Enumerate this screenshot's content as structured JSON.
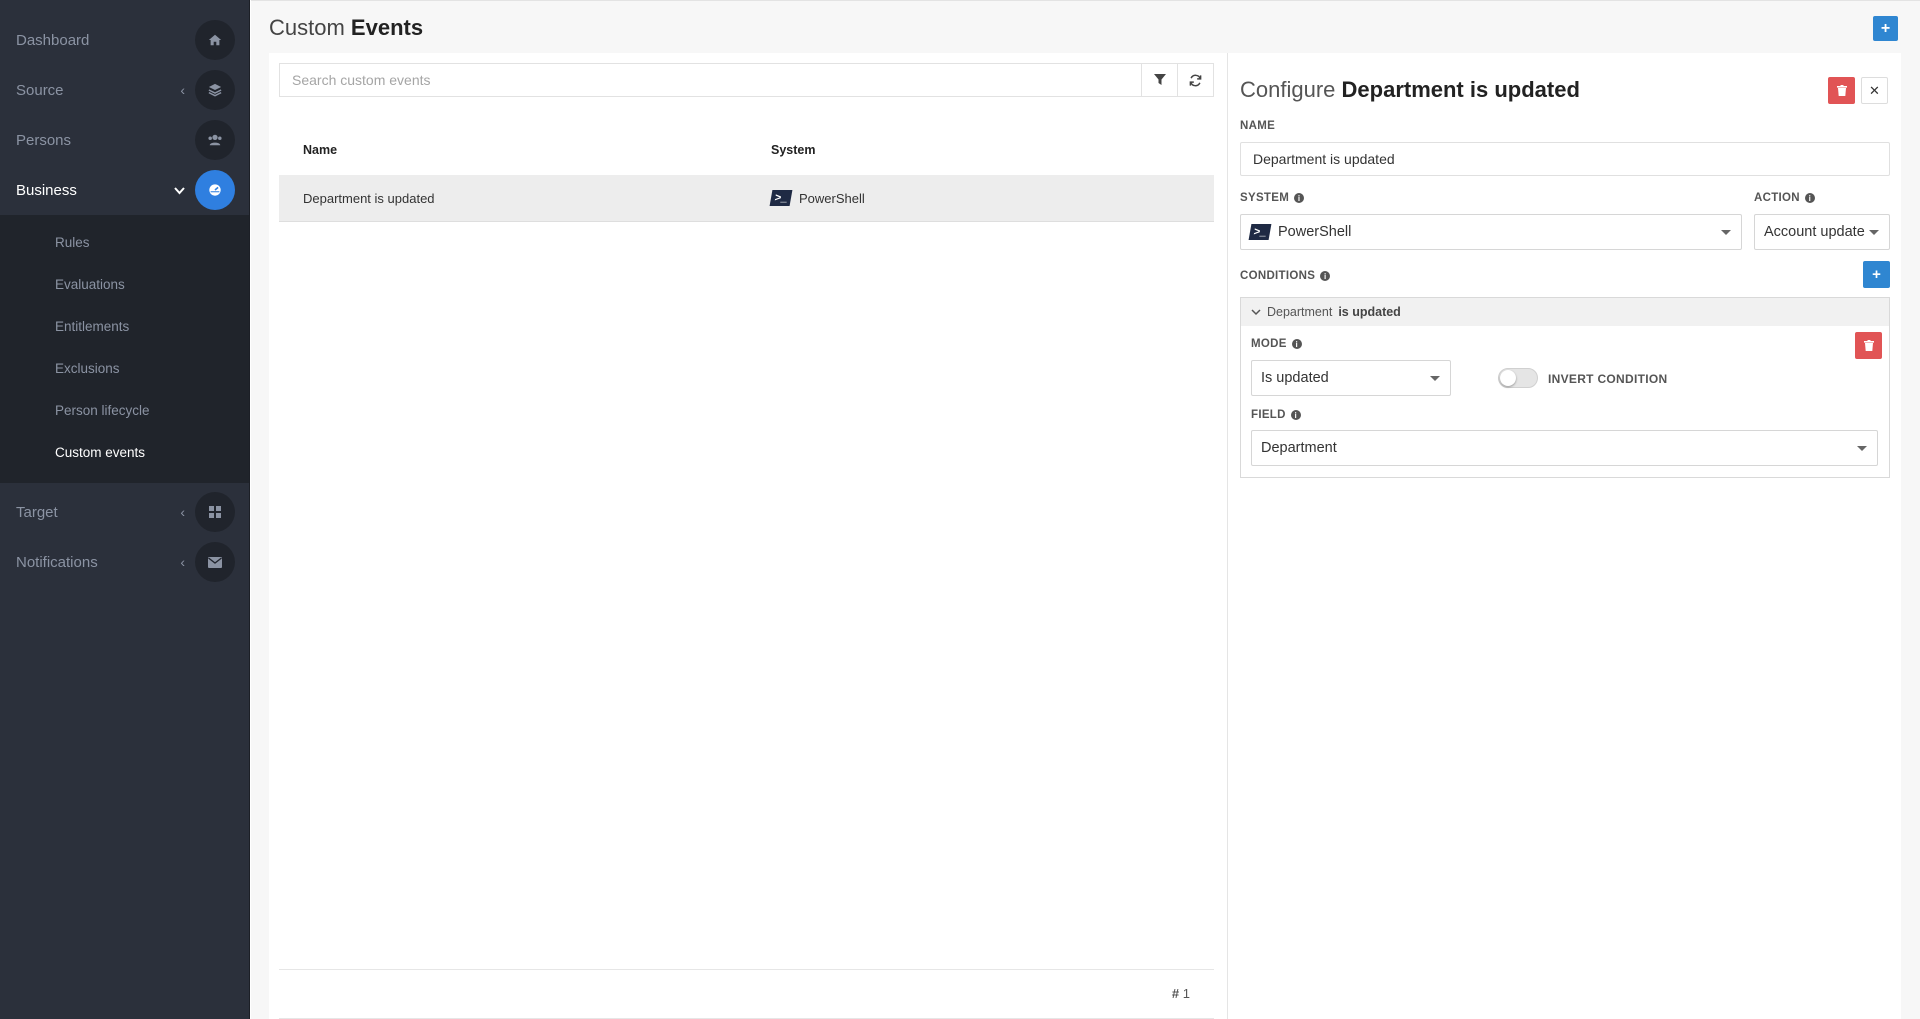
{
  "sidebar": {
    "items": [
      {
        "label": "Dashboard",
        "icon": "home-icon"
      },
      {
        "label": "Source",
        "icon": "layers-icon"
      },
      {
        "label": "Persons",
        "icon": "users-icon"
      },
      {
        "label": "Business",
        "icon": "dashboard-gauge-icon"
      },
      {
        "label": "Target",
        "icon": "grid-icon"
      },
      {
        "label": "Notifications",
        "icon": "envelope-icon"
      }
    ],
    "business_sub": [
      "Rules",
      "Evaluations",
      "Entitlements",
      "Exclusions",
      "Person lifecycle",
      "Custom events"
    ],
    "active_item": "Business",
    "active_sub": "Custom events"
  },
  "header": {
    "title_light": "Custom",
    "title_bold": "Events"
  },
  "list": {
    "search_placeholder": "Search custom events",
    "columns": [
      "Name",
      "System"
    ],
    "rows": [
      {
        "name": "Department is updated",
        "system": "PowerShell"
      }
    ],
    "count_symbol": "#",
    "count": "1"
  },
  "config": {
    "title_light": "Configure",
    "title_bold": "Department is updated",
    "name_label": "NAME",
    "name_value": "Department is updated",
    "system_label": "SYSTEM",
    "system_value": "PowerShell",
    "action_label": "ACTION",
    "action_value": "Account update",
    "conditions_label": "CONDITIONS",
    "condition": {
      "field_text": "Department",
      "op_text": "is updated",
      "mode_label": "MODE",
      "mode_value": "Is updated",
      "invert_label": "INVERT CONDITION",
      "invert_on": false,
      "field_label": "FIELD",
      "field_value": "Department"
    }
  },
  "colors": {
    "sidebar_bg": "#2b303b",
    "accent_blue": "#2f86d1",
    "active_circle": "#2f7fe0",
    "danger": "#e15455"
  }
}
